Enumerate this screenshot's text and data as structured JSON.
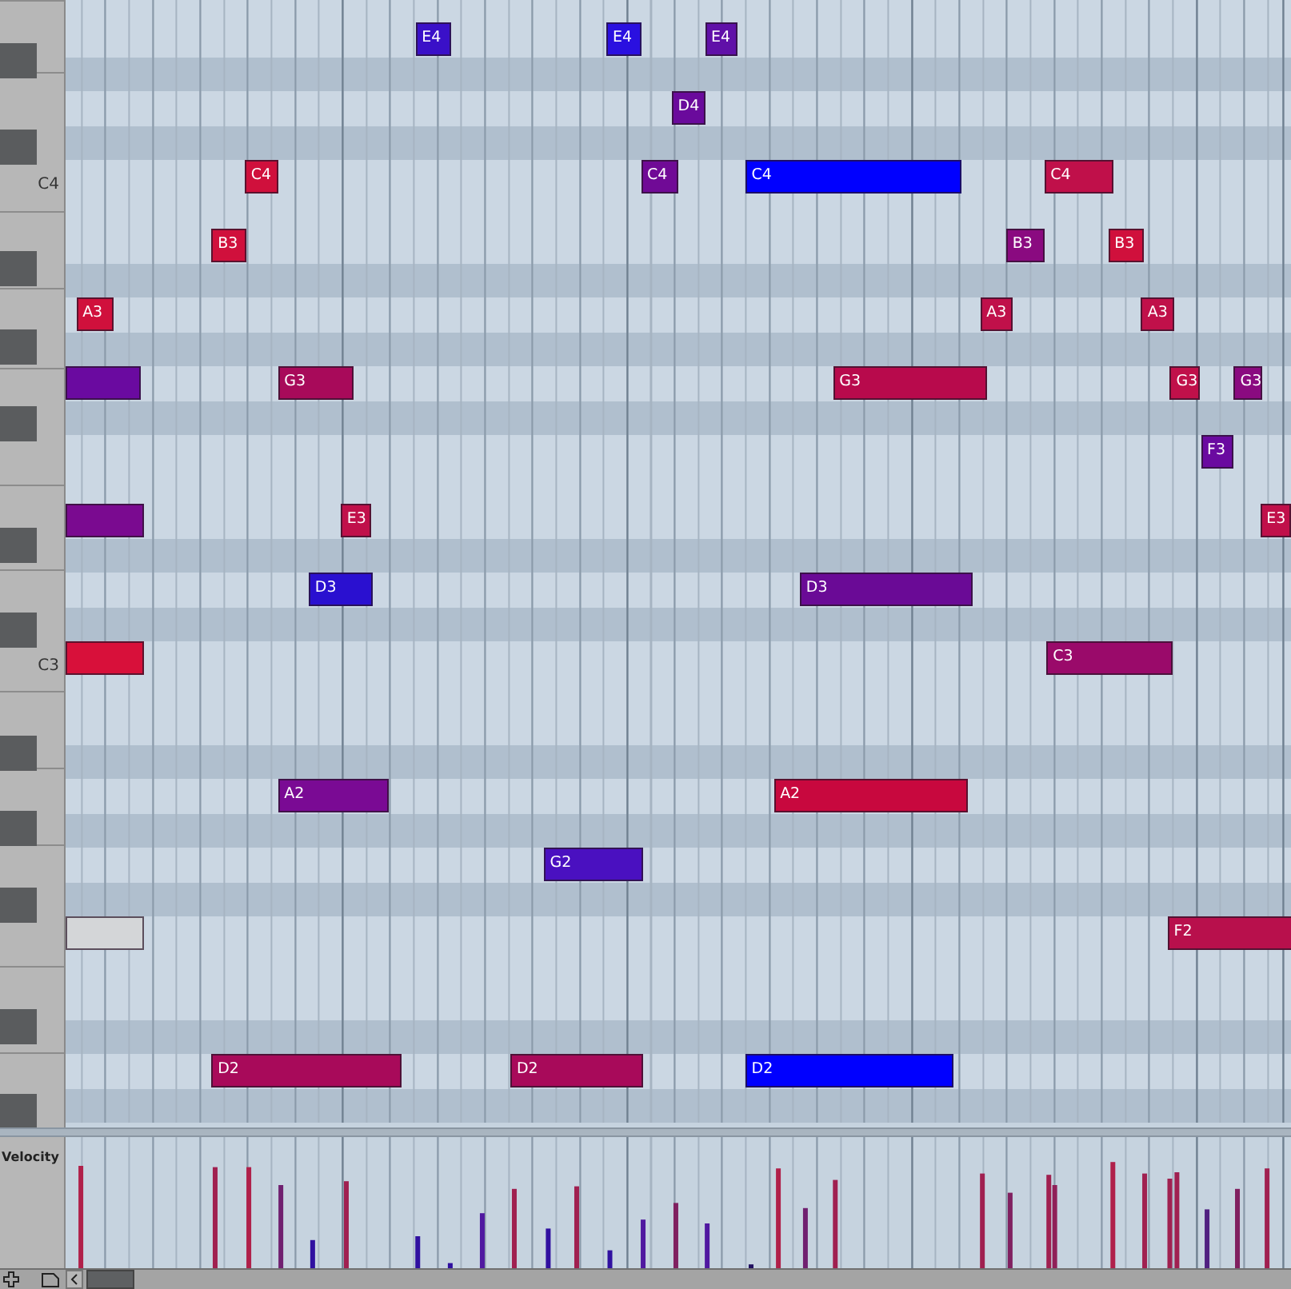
{
  "rows": [
    {
      "shaded": false,
      "notes": []
    },
    {
      "shaded": false,
      "notes": [
        {
          "label": "E4",
          "color": "#3a10c8"
        },
        {
          "label": "E4",
          "color": "#2a10e0"
        },
        {
          "label": "E4",
          "color": "#6010a8"
        }
      ]
    },
    {
      "shaded": true,
      "notes": []
    },
    {
      "shaded": false,
      "notes": [
        {
          "label": "D4",
          "color": "#6a0a9c"
        }
      ]
    },
    {
      "shaded": true,
      "notes": []
    },
    {
      "shaded": false,
      "key_label": "C4",
      "notes": [
        {
          "label": "C4",
          "color": "#d0103c"
        },
        {
          "label": "C4",
          "color": "#700a96"
        },
        {
          "label": "C4",
          "color": "#0000ff"
        },
        {
          "label": "C4",
          "color": "#c0104a"
        }
      ]
    },
    {
      "shaded": false,
      "notes": []
    },
    {
      "shaded": false,
      "notes": [
        {
          "label": "B3",
          "color": "#d0103c"
        },
        {
          "label": "B3",
          "color": "#8a0a80"
        },
        {
          "label": "B3",
          "color": "#d0103c"
        }
      ]
    },
    {
      "shaded": true,
      "notes": []
    },
    {
      "shaded": false,
      "notes": [
        {
          "label": "A3",
          "color": "#d0103c"
        },
        {
          "label": "A3",
          "color": "#c0104a"
        },
        {
          "label": "A3",
          "color": "#c0104a"
        }
      ]
    },
    {
      "shaded": true,
      "notes": []
    },
    {
      "shaded": false,
      "notes": [
        {
          "color": "#6a0aa0"
        },
        {
          "label": "G3",
          "color": "#a80a5a"
        },
        {
          "label": "G3",
          "color": "#b80a4c"
        },
        {
          "label": "G3",
          "color": "#c0104a"
        },
        {
          "label": "G3",
          "color": "#8a0a80"
        }
      ]
    },
    {
      "shaded": true,
      "notes": []
    },
    {
      "shaded": false,
      "notes": [
        {
          "label": "F3",
          "color": "#6a0aa0"
        }
      ]
    },
    {
      "shaded": false,
      "notes": []
    },
    {
      "shaded": false,
      "notes": [
        {
          "color": "#7a0a90"
        },
        {
          "label": "E3",
          "color": "#c0104a"
        },
        {
          "label": "E3",
          "color": "#c0104a"
        }
      ]
    },
    {
      "shaded": true,
      "notes": []
    },
    {
      "shaded": false,
      "notes": [
        {
          "label": "D3",
          "color": "#2a10d0"
        },
        {
          "label": "D3",
          "color": "#6a0a96"
        }
      ]
    },
    {
      "shaded": true,
      "notes": []
    },
    {
      "shaded": false,
      "key_label": "C3",
      "notes": [
        {
          "color": "#d8103a"
        },
        {
          "label": "C3",
          "color": "#9a0a6a"
        }
      ]
    },
    {
      "shaded": false,
      "notes": []
    },
    {
      "shaded": false,
      "notes": []
    },
    {
      "shaded": true,
      "notes": []
    },
    {
      "shaded": false,
      "notes": [
        {
          "label": "A2",
          "color": "#7a0a94"
        },
        {
          "label": "A2",
          "color": "#c8083e"
        }
      ]
    },
    {
      "shaded": true,
      "notes": []
    },
    {
      "shaded": false,
      "notes": [
        {
          "label": "G2",
          "color": "#4a10c0"
        }
      ]
    },
    {
      "shaded": true,
      "notes": []
    },
    {
      "shaded": false,
      "notes": [
        {
          "color": "#d4d6d8"
        },
        {
          "label": "F2",
          "color": "#b8104c"
        }
      ]
    },
    {
      "shaded": false,
      "notes": []
    },
    {
      "shaded": false,
      "notes": []
    },
    {
      "shaded": true,
      "notes": []
    },
    {
      "shaded": false,
      "notes": [
        {
          "label": "D2",
          "color": "#a80a5a"
        },
        {
          "label": "D2",
          "color": "#a80a5a"
        },
        {
          "label": "D2",
          "color": "#0000ff"
        }
      ]
    },
    {
      "shaded": true,
      "notes": []
    }
  ],
  "velocity": {
    "label": "Velocity"
  }
}
